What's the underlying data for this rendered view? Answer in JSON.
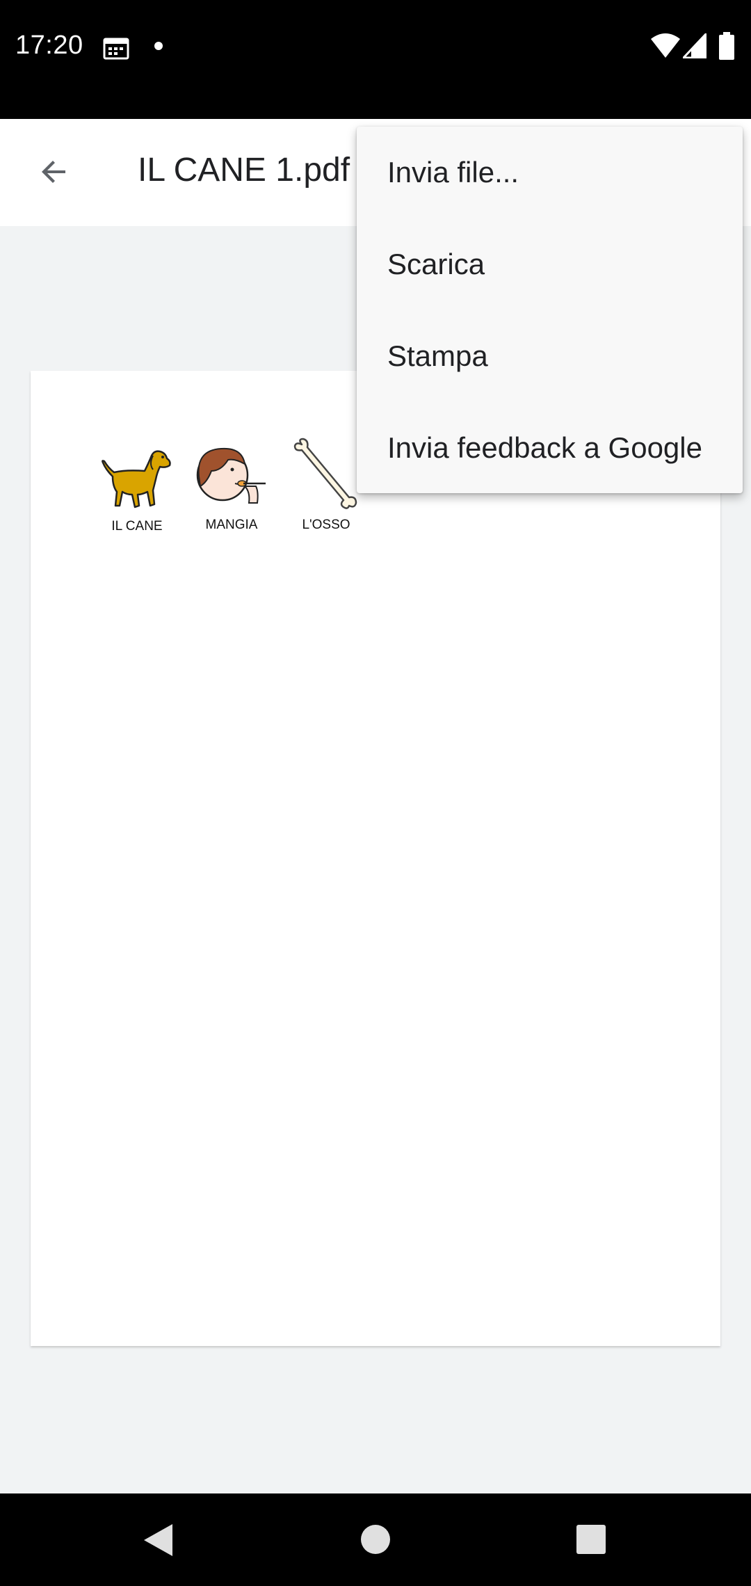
{
  "status_bar": {
    "time": "17:20",
    "icons": [
      "calendar-icon",
      "dot-icon",
      "wifi-icon",
      "signal-icon",
      "battery-icon"
    ]
  },
  "app_bar": {
    "back_icon": "arrow-back-icon",
    "title": "IL CANE 1.pdf"
  },
  "document": {
    "symbols": [
      {
        "label": "IL CANE",
        "icon": "dog-icon"
      },
      {
        "label": "MANGIA",
        "icon": "eating-person-icon"
      },
      {
        "label": "L'OSSO",
        "icon": "bone-icon"
      }
    ]
  },
  "overflow_menu": {
    "items": [
      {
        "label": "Invia file..."
      },
      {
        "label": "Scarica"
      },
      {
        "label": "Stampa"
      },
      {
        "label": "Invia feedback a Google"
      }
    ]
  },
  "nav_bar": {
    "buttons": [
      "back-triangle-icon",
      "home-circle-icon",
      "recents-square-icon"
    ]
  },
  "colors": {
    "status_bar_bg": "#000000",
    "app_bar_bg": "#ffffff",
    "viewer_bg": "#f1f3f4",
    "menu_bg": "#f8f8f8",
    "dog_fill": "#d9a400"
  }
}
